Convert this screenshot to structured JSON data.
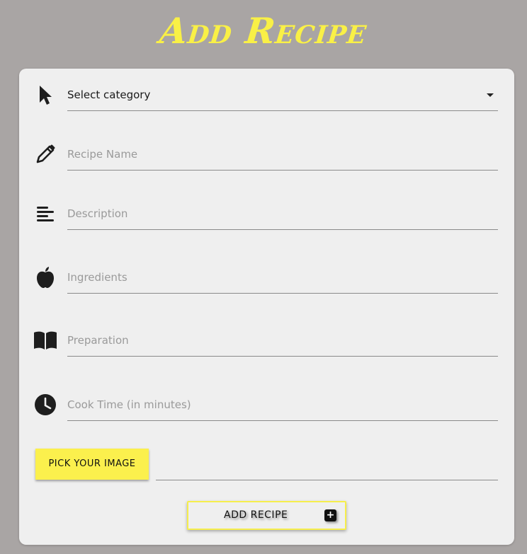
{
  "title": "Add Recipe",
  "form": {
    "category": {
      "value": "Select category",
      "icon": "cursor-pointer-icon"
    },
    "recipe_name": {
      "placeholder": "Recipe Name",
      "icon": "pencil-icon"
    },
    "description": {
      "placeholder": "Description",
      "icon": "text-align-left-icon"
    },
    "ingredients": {
      "placeholder": "Ingredients",
      "icon": "apple-icon"
    },
    "preparation": {
      "placeholder": "Preparation",
      "icon": "book-icon"
    },
    "cook_time": {
      "placeholder": "Cook Time (in minutes)",
      "icon": "clock-icon"
    }
  },
  "buttons": {
    "pick_image": "PICK YOUR IMAGE",
    "add_recipe": "ADD RECIPE",
    "add_recipe_icon": "+"
  },
  "colors": {
    "background": "#a9a5a4",
    "accent_yellow": "#fbf04d",
    "card": "#efefef"
  }
}
